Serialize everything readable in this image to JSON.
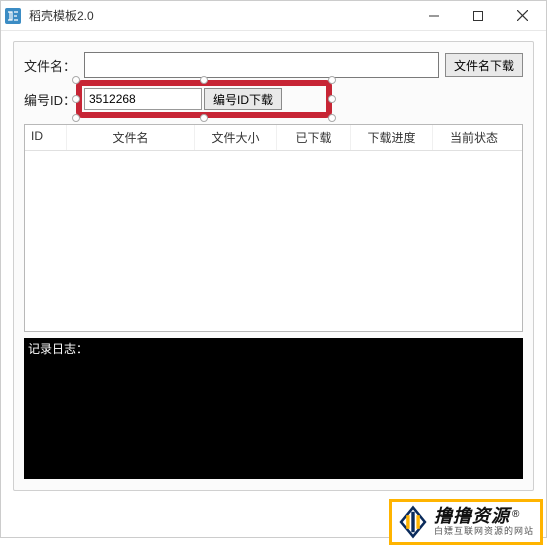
{
  "window": {
    "title": "稻壳模板2.0"
  },
  "form": {
    "filename_label": "文件名：",
    "filename_value": "",
    "filename_download_btn": "文件名下载",
    "id_label": "编号ID：",
    "id_value": "3512268",
    "id_download_btn": "编号ID下载"
  },
  "listview": {
    "columns": [
      "ID",
      "文件名",
      "文件大小",
      "已下载",
      "下载进度",
      "当前状态"
    ],
    "rows": []
  },
  "log": {
    "label": "记录日志：",
    "content": ""
  },
  "watermark": {
    "main": "撸撸资源",
    "reg": "®",
    "sub": "白嫖互联网资源的网站"
  },
  "icons": {
    "app": "app-icon",
    "minimize": "minimize-icon",
    "maximize": "maximize-icon",
    "close": "close-icon"
  }
}
